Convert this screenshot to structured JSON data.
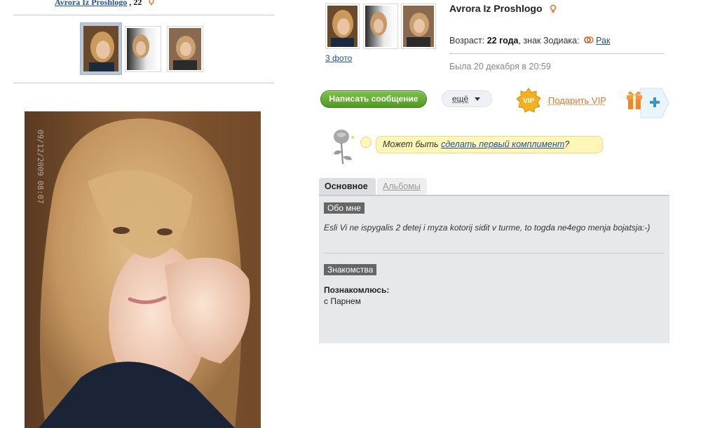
{
  "top": {
    "name_link": "Avrora Iz Proshlogo",
    "age": " , 22"
  },
  "profile": {
    "name": "Avrora Iz Proshlogo",
    "photos_link": "3 фото",
    "age_prefix": "Возраст: ",
    "age_value": "22 года",
    "zodiac_prefix": ", знак Зодиака:",
    "zodiac_value": "Рак",
    "last_seen": "Была 20 декабря в 20:59"
  },
  "actions": {
    "message_button": "Написать сообщение",
    "more_button": "ещё",
    "gift_vip": "Подарить VIP",
    "vip_badge_text": "VIP"
  },
  "compliment": {
    "prefix": "Может быть ",
    "link": "сделать первый комплимент",
    "suffix": "?"
  },
  "tabs": [
    {
      "label": "Основное",
      "active": true
    },
    {
      "label": "Альбомы",
      "active": false
    }
  ],
  "about": {
    "heading": "Обо мне",
    "text": "Esli Vi ne ispygalis 2 detej i myza kotorij sidit v turme, to togda ne4ego menja bojatsja:-)"
  },
  "dating": {
    "heading": "Знакомства",
    "label": "Познакомлюсь:",
    "value": "с Парнем"
  },
  "photo_stamp": "09/12/2009 08:07",
  "colors": {
    "link": "#1f4fa0",
    "message_button": "#5aa52a",
    "vip_orange": "#e2762c",
    "compliment_bg": "#fff6b8",
    "panel_bg": "#e7e8ea"
  }
}
